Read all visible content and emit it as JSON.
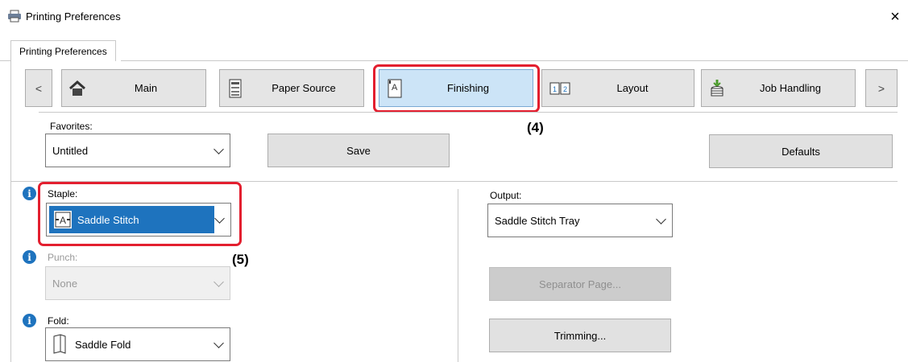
{
  "window": {
    "title": "Printing Preferences",
    "close_glyph": "×",
    "icon": "printer-icon"
  },
  "tab": {
    "label": "Printing Preferences"
  },
  "nav": {
    "prev": "<",
    "next": ">",
    "items": [
      {
        "label": "Main",
        "icon": "home-icon"
      },
      {
        "label": "Paper Source",
        "icon": "paper-tray-icon"
      },
      {
        "label": "Finishing",
        "icon": "finishing-icon",
        "active": true
      },
      {
        "label": "Layout",
        "icon": "layout-icon"
      },
      {
        "label": "Job Handling",
        "icon": "job-handling-icon"
      }
    ]
  },
  "favorites": {
    "label": "Favorites:",
    "value": "Untitled",
    "save": "Save",
    "defaults": "Defaults"
  },
  "staple": {
    "label": "Staple:",
    "value": "Saddle Stitch"
  },
  "punch": {
    "label": "Punch:",
    "value": "None"
  },
  "fold": {
    "label": "Fold:",
    "value": "Saddle Fold"
  },
  "output": {
    "label": "Output:",
    "value": "Saddle Stitch Tray"
  },
  "separator_button": "Separator Page...",
  "trimming_button": "Trimming...",
  "callouts": {
    "c4": "(4)",
    "c5": "(5)"
  },
  "colors": {
    "highlight_red": "#e31f2f",
    "selected_blue": "#1e73be",
    "active_tab": "#cce4f7"
  }
}
